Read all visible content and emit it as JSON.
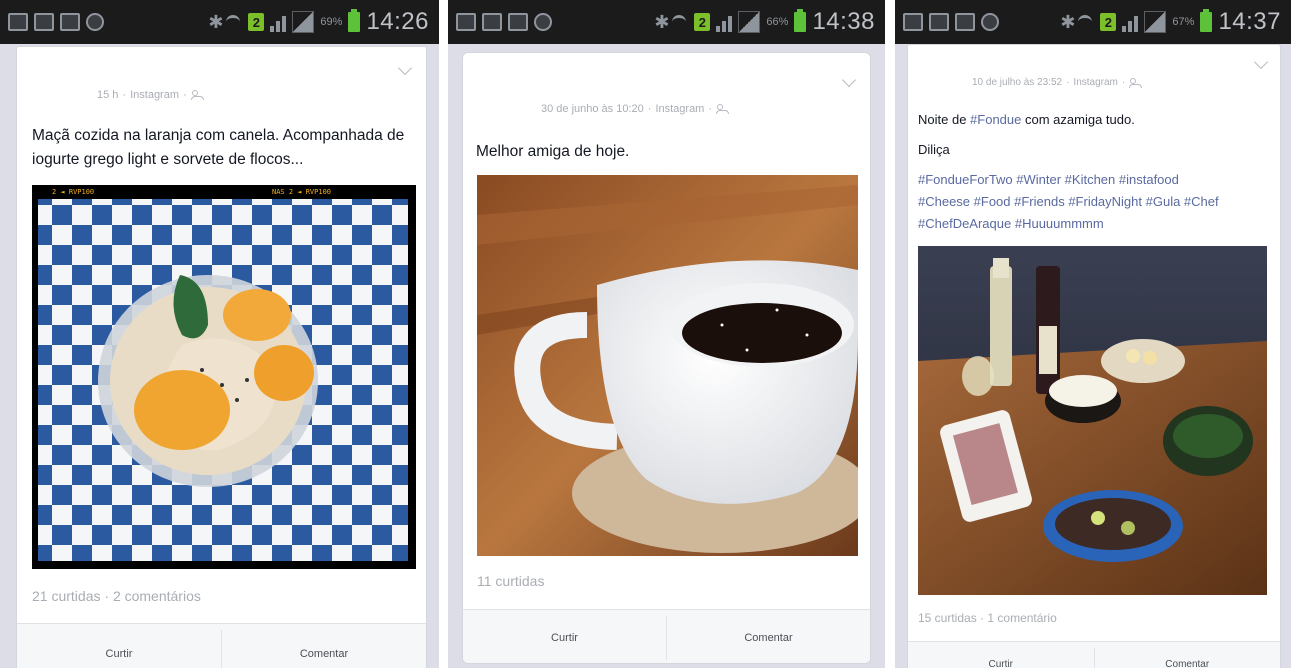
{
  "screens": [
    {
      "status_bar": {
        "battery_percent": "69%",
        "time": "14:26"
      },
      "post": {
        "meta": {
          "time": "15 h",
          "source": "Instagram"
        },
        "caption": "Maçã cozida na laranja com canela. Acompanhada de iogurte grego light e sorvete de flocos...",
        "photo": {
          "film_text": [
            "2 ◄ RVP100",
            "NAS 2 ◄ RVP100"
          ]
        },
        "stats": {
          "likes": "21 curtidas",
          "separator": "·",
          "comments": "2 comentários"
        },
        "actions": {
          "like": "Curtir",
          "comment": "Comentar"
        }
      }
    },
    {
      "status_bar": {
        "battery_percent": "66%",
        "time": "14:38"
      },
      "post": {
        "meta": {
          "time": "30 de junho às 10:20",
          "source": "Instagram"
        },
        "caption": "Melhor amiga de hoje.",
        "stats": {
          "likes": "11 curtidas"
        },
        "actions": {
          "like": "Curtir",
          "comment": "Comentar"
        }
      }
    },
    {
      "status_bar": {
        "battery_percent": "67%",
        "time": "14:37"
      },
      "post": {
        "meta": {
          "time": "10 de julho às 23:52",
          "source": "Instagram"
        },
        "caption": {
          "before": "Noite de ",
          "hashtag": "#Fondue",
          "after": " com azamiga tudo.",
          "second_line": "Diliça"
        },
        "hashtag_lines": [
          "#FondueForTwo #Winter #Kitchen #instafood",
          "#Cheese #Food #Friends #FridayNight #Gula #Chef",
          "#ChefDeAraque #Huuuummmm"
        ],
        "stats": {
          "likes": "15 curtidas",
          "separator": "·",
          "comments": "1 comentário"
        },
        "actions": {
          "like": "Curtir",
          "comment": "Comentar"
        }
      }
    }
  ],
  "colors": {
    "hashtag_blue": "#5a6aa0",
    "background": "#dcdde6",
    "status_bar": "#1b1b1b",
    "battery_green": "#5ec13a"
  }
}
